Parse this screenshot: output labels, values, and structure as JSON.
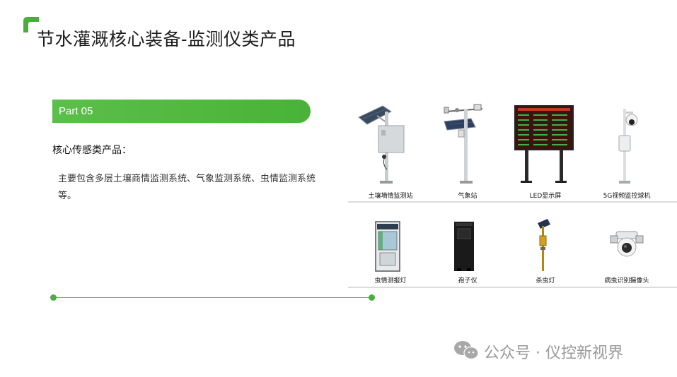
{
  "page": {
    "title": "节水灌溉核心装备-监测仪类产品",
    "accent_color": "#4aae3b"
  },
  "part": {
    "label": "Part 05"
  },
  "section": {
    "heading": "核心传感类产品：",
    "description": "主要包含多层土壤商情监测系统、气象监测系统、虫情监测系统等。"
  },
  "products": [
    {
      "name": "土壤墒情监测站",
      "icon": "soil-station-icon"
    },
    {
      "name": "气象站",
      "icon": "weather-station-icon"
    },
    {
      "name": "LED显示屏",
      "icon": "led-screen-icon"
    },
    {
      "name": "5G视频监控球机",
      "icon": "dome-camera-icon"
    },
    {
      "name": "虫情测报灯",
      "icon": "pest-forecast-lamp-icon"
    },
    {
      "name": "孢子仪",
      "icon": "spore-trap-icon"
    },
    {
      "name": "杀虫灯",
      "icon": "insect-killer-lamp-icon"
    },
    {
      "name": "病虫识别摄像头",
      "icon": "pest-recognition-camera-icon"
    }
  ],
  "watermark": {
    "text": "公众号 · 仪控新视界",
    "icon": "wechat-icon"
  }
}
